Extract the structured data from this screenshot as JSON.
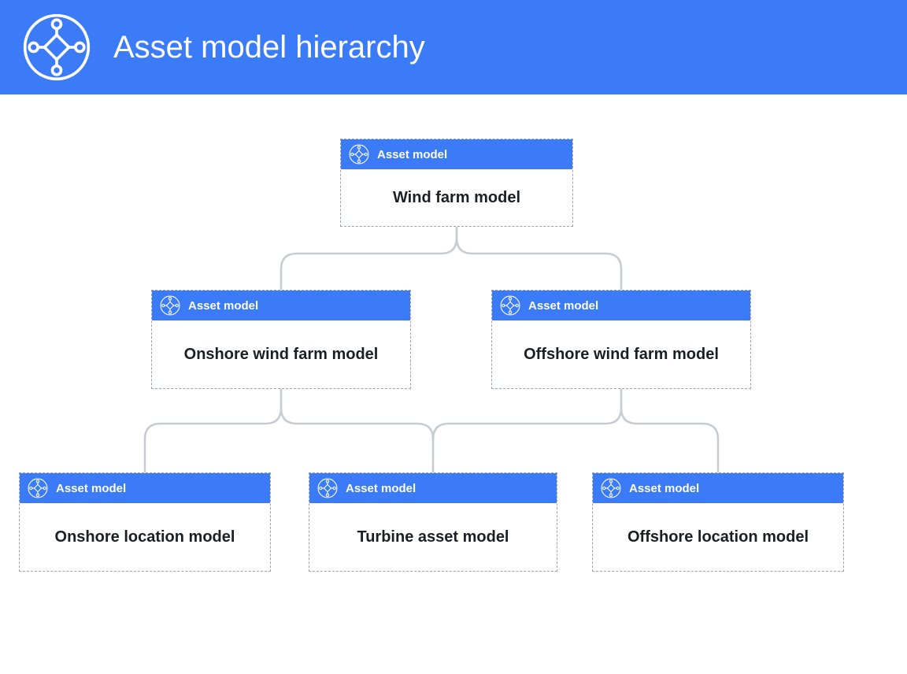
{
  "colors": {
    "primary": "#3b7bf7",
    "text": "#1a1f24",
    "connector": "#c7ccd1",
    "node_border": "#9aa3ad"
  },
  "banner": {
    "title": "Asset model hierarchy"
  },
  "node_type_label": "Asset model",
  "nodes": {
    "root": {
      "title": "Wind farm model"
    },
    "onshore": {
      "title": "Onshore wind farm model"
    },
    "offshore": {
      "title": "Offshore wind farm model"
    },
    "onloc": {
      "title": "Onshore location model"
    },
    "turbine": {
      "title": "Turbine asset model"
    },
    "offloc": {
      "title": "Offshore location model"
    }
  },
  "hierarchy": {
    "root": [
      "onshore",
      "offshore"
    ],
    "onshore": [
      "onloc",
      "turbine"
    ],
    "offshore": [
      "turbine",
      "offloc"
    ]
  }
}
